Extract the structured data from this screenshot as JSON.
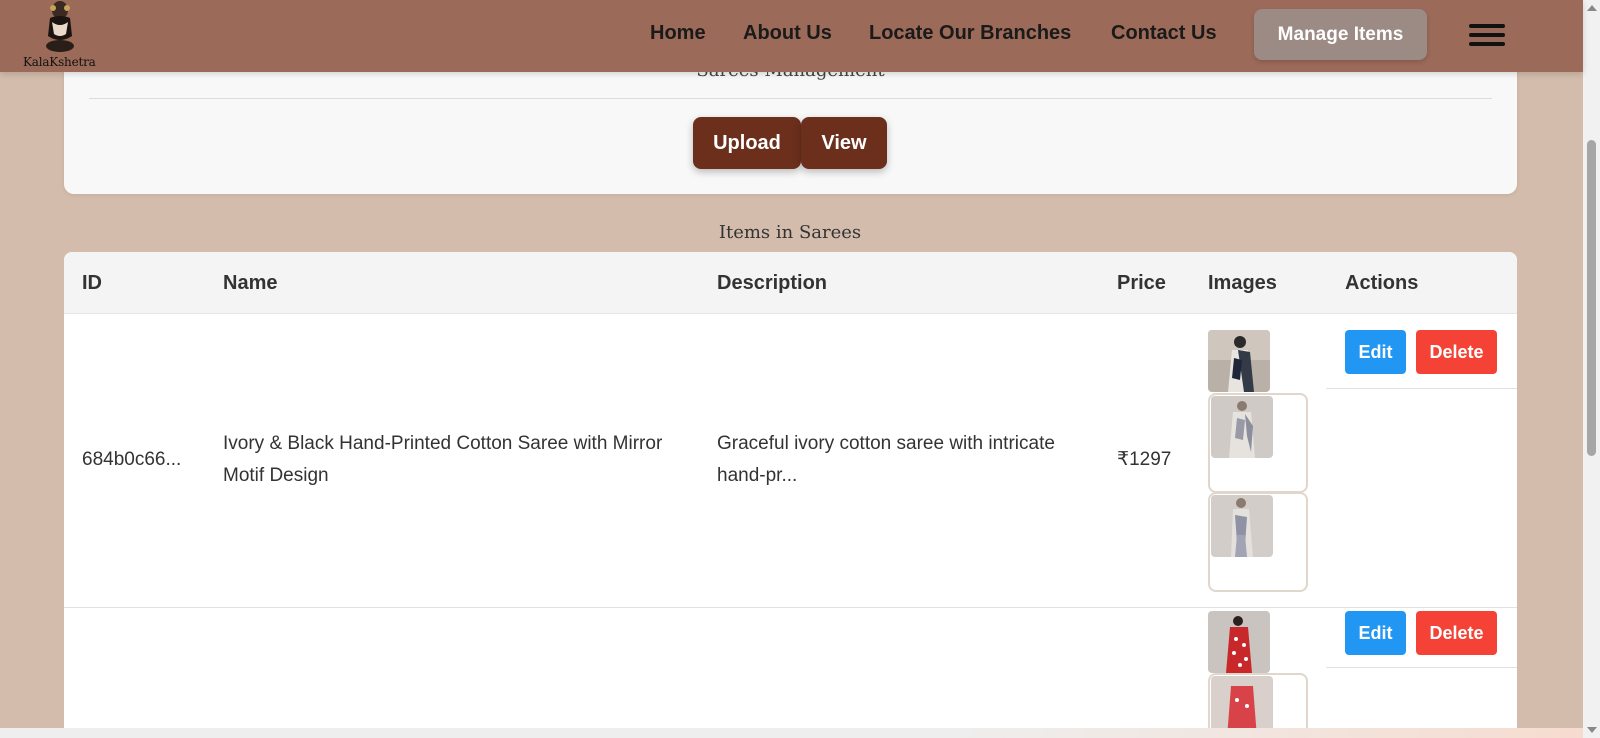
{
  "brand": {
    "name": "KalaKshetra"
  },
  "nav": {
    "home": "Home",
    "about": "About Us",
    "branches": "Locate Our Branches",
    "contact": "Contact Us",
    "manage": "Manage Items"
  },
  "management": {
    "title": "Sarees Management",
    "upload": "Upload",
    "view": "View"
  },
  "section_title": "Items in Sarees",
  "table": {
    "headers": {
      "id": "ID",
      "name": "Name",
      "description": "Description",
      "price": "Price",
      "images": "Images",
      "actions": "Actions"
    },
    "rows": [
      {
        "id": "684b0c66...",
        "name": "Ivory & Black Hand-Printed Cotton Saree with Mirror Motif Design",
        "description": "Graceful ivory cotton saree with intricate hand-pr...",
        "price": "₹1297",
        "edit": "Edit",
        "delete": "Delete"
      },
      {
        "id": "",
        "name": "",
        "description": "",
        "price": "",
        "edit": "Edit",
        "delete": "Delete"
      }
    ]
  },
  "colors": {
    "navbar": "#9b6a58",
    "page_bg": "#d3bcac",
    "primary_button": "#6b2f1c",
    "edit": "#2196f3",
    "delete": "#f44336",
    "manage_button": "#9c8a84"
  },
  "icons": [
    "brand-logo",
    "hamburger-menu-icon",
    "saree-photo"
  ]
}
